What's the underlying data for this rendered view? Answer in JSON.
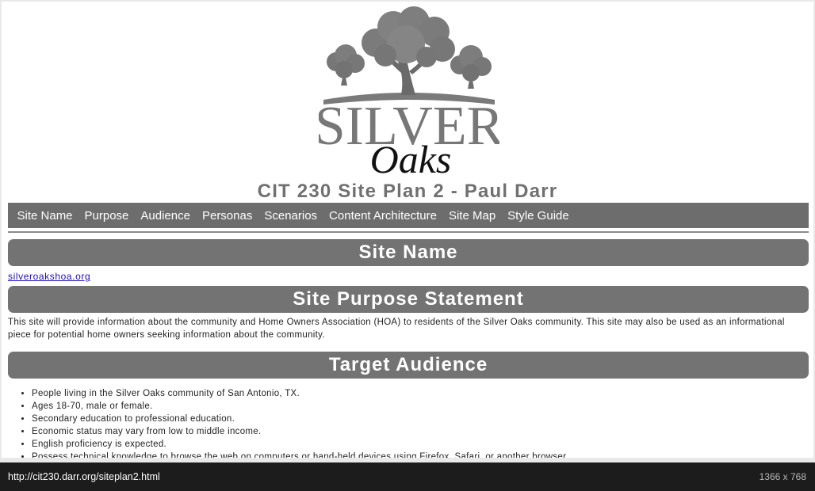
{
  "page": {
    "logo": {
      "icon": "silver-oaks-tree-logo",
      "word1": "SILVER",
      "word2": "Oaks"
    },
    "title": "CIT 230 Site Plan 2 - Paul Darr",
    "nav": [
      "Site Name",
      "Purpose",
      "Audience",
      "Personas",
      "Scenarios",
      "Content Architecture",
      "Site Map",
      "Style Guide"
    ],
    "sections": {
      "site_name": {
        "heading": "Site Name",
        "link": "silveroakshoa.org"
      },
      "purpose": {
        "heading": "Site Purpose Statement",
        "text": "This site will provide information about the community and Home Owners Association (HOA) to residents of the Silver Oaks community. This site may also be used as an informational piece for potential home owners seeking information about the community."
      },
      "audience": {
        "heading": "Target Audience",
        "items": [
          "People living in the Silver Oaks community of San Antonio, TX.",
          "Ages 18-70, male or female.",
          "Secondary education to professional education.",
          "Economic status may vary from low to middle income.",
          "English proficiency is expected.",
          "Possess technical knowledge to browse the web on computers or hand-held devices using Firefox, Safari, or another browser."
        ]
      }
    }
  },
  "status": {
    "url": "http://cit230.darr.org/siteplan2.html",
    "size": "1366 x 768"
  },
  "colors": {
    "header_bg": "#737373",
    "nav_bg": "#6d6d6d",
    "title": "#707070",
    "link": "#1a0dab"
  }
}
